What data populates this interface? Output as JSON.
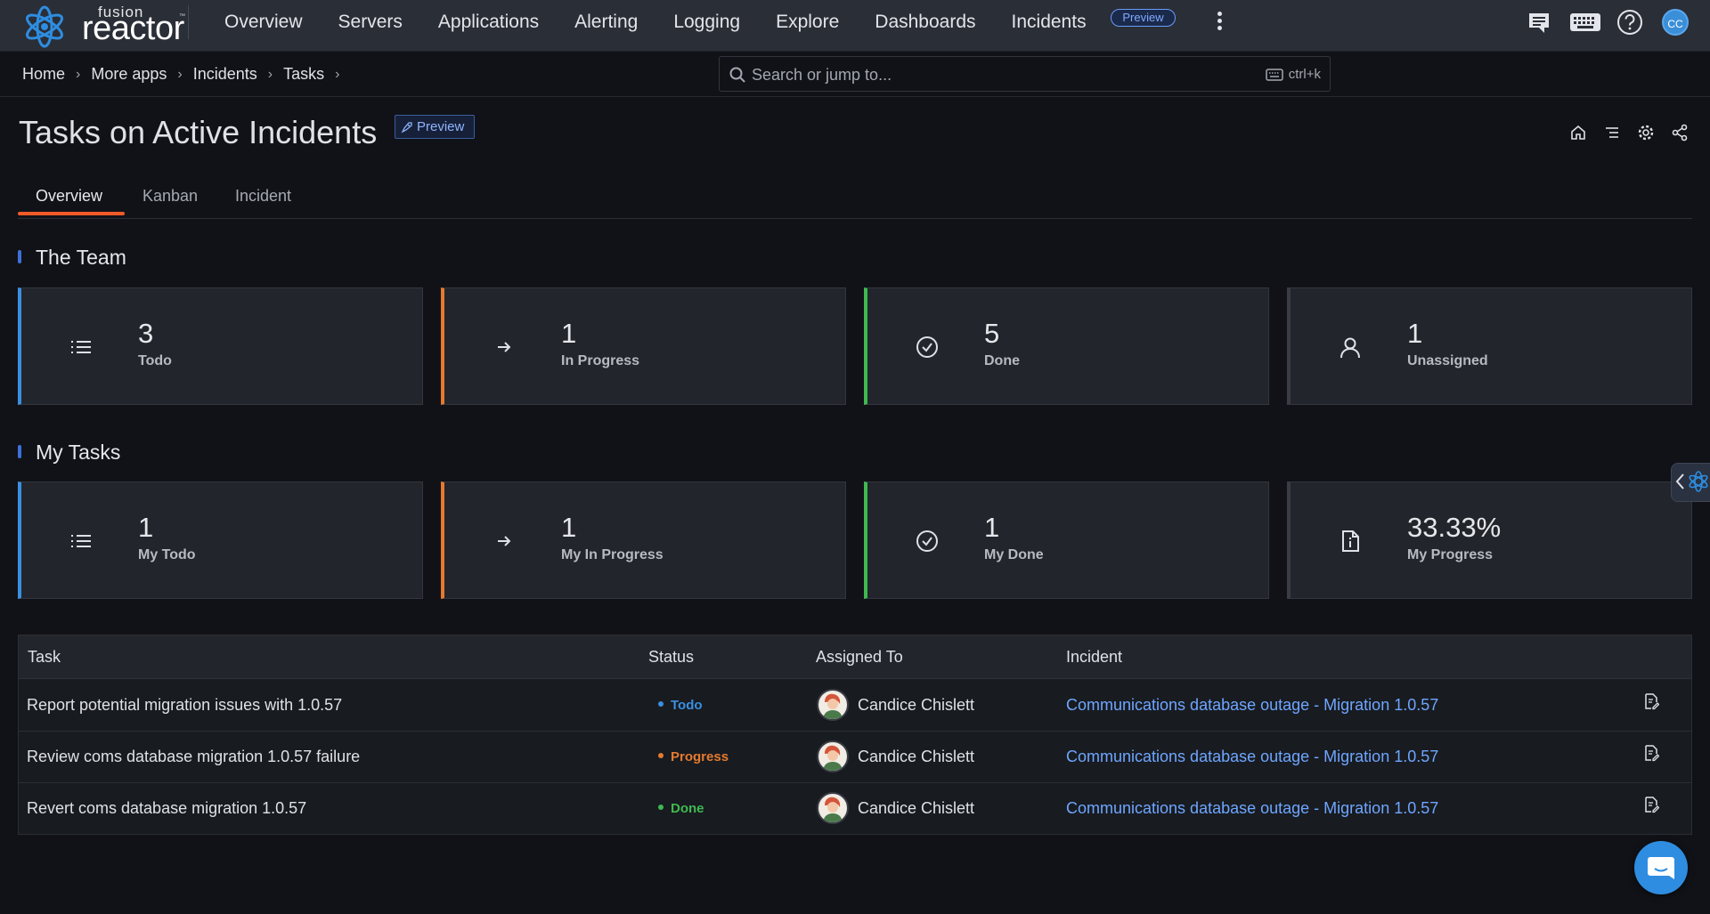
{
  "brand": {
    "top": "fusion",
    "name": "reactor",
    "mark": "™"
  },
  "nav": {
    "items": [
      "Overview",
      "Servers",
      "Applications",
      "Alerting",
      "Logging",
      "Explore",
      "Dashboards",
      "Incidents"
    ],
    "incidents_badge": "Preview",
    "avatar_initials": "CC"
  },
  "breadcrumb": [
    "Home",
    "More apps",
    "Incidents",
    "Tasks"
  ],
  "search": {
    "placeholder": "Search or jump to...",
    "shortcut": "ctrl+k"
  },
  "page": {
    "title": "Tasks on Active Incidents",
    "badge": "Preview"
  },
  "tabs": [
    "Overview",
    "Kanban",
    "Incident"
  ],
  "team": {
    "title": "The Team",
    "cards": [
      {
        "value": "3",
        "label": "Todo",
        "icon": "list-icon",
        "accent": "#3b8fe0"
      },
      {
        "value": "1",
        "label": "In Progress",
        "icon": "arrow-right-icon",
        "accent": "#e57a2f"
      },
      {
        "value": "5",
        "label": "Done",
        "icon": "check-circle-icon",
        "accent": "#3fb950"
      },
      {
        "value": "1",
        "label": "Unassigned",
        "icon": "user-icon",
        "accent": "#3a3d45"
      }
    ]
  },
  "my_tasks": {
    "title": "My Tasks",
    "cards": [
      {
        "value": "1",
        "label": "My Todo",
        "icon": "list-icon",
        "accent": "#3b8fe0"
      },
      {
        "value": "1",
        "label": "My In Progress",
        "icon": "arrow-right-icon",
        "accent": "#e57a2f"
      },
      {
        "value": "1",
        "label": "My Done",
        "icon": "check-circle-icon",
        "accent": "#3fb950"
      },
      {
        "value": "33.33%",
        "label": "My Progress",
        "icon": "file-info-icon",
        "accent": "#3a3d45"
      }
    ]
  },
  "table": {
    "headers": [
      "Task",
      "Status",
      "Assigned To",
      "Incident"
    ],
    "rows": [
      {
        "task": "Report potential migration issues with 1.0.57",
        "status": "Todo",
        "status_color": "#3b8fe0",
        "assignee": "Candice Chislett",
        "incident": "Communications database outage - Migration 1.0.57"
      },
      {
        "task": "Review coms database migration 1.0.57 failure",
        "status": "Progress",
        "status_color": "#e57a2f",
        "assignee": "Candice Chislett",
        "incident": "Communications database outage - Migration 1.0.57"
      },
      {
        "task": "Revert coms database migration 1.0.57",
        "status": "Done",
        "status_color": "#3fb950",
        "assignee": "Candice Chislett",
        "incident": "Communications database outage - Migration 1.0.57"
      }
    ]
  }
}
